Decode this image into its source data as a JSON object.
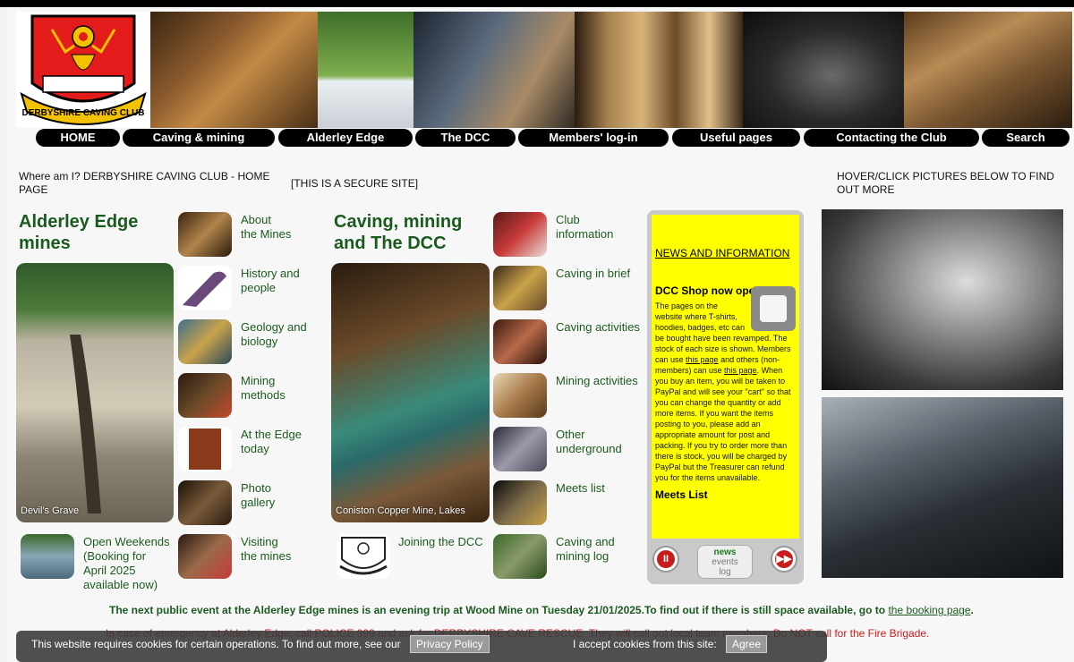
{
  "nav": [
    "HOME",
    "Caving & mining",
    "Alderley Edge",
    "The DCC",
    "Members' log-in",
    "Useful pages",
    "Contacting the Club",
    "Search"
  ],
  "logo": {
    "text": "DERBYSHIRE CAVING CLUB"
  },
  "where_am_i": "Where am I?  DERBYSHIRE CAVING CLUB - HOME PAGE",
  "secure": "[THIS IS A SECURE SITE]",
  "hover_note": "HOVER/CLICK PICTURES BELOW TO FIND OUT MORE",
  "col1": {
    "title_l1": "Alderley Edge",
    "title_l2": "mines",
    "big_caption": "Devil's Grave",
    "items": [
      {
        "l1": "About",
        "l2": "the Mines"
      },
      {
        "l1": "History and",
        "l2": "people"
      },
      {
        "l1": "Geology and",
        "l2": "biology"
      },
      {
        "l1": "Mining",
        "l2": "methods"
      },
      {
        "l1": "At the Edge",
        "l2": "today"
      },
      {
        "l1": "Photo",
        "l2": "gallery"
      },
      {
        "l1": "Visiting",
        "l2": "the mines"
      }
    ],
    "open_weekends": [
      "Open Weekends",
      "(Booking for",
      "April 2025",
      "available now)"
    ]
  },
  "col2": {
    "title_l1": "Caving, mining",
    "title_l2": "and The DCC",
    "big_caption": "Coniston Copper Mine, Lakes",
    "items": [
      {
        "l1": "Club",
        "l2": "information"
      },
      {
        "l1": "Caving in brief",
        "l2": ""
      },
      {
        "l1": "Caving activities",
        "l2": ""
      },
      {
        "l1": "Mining activities",
        "l2": ""
      },
      {
        "l1": "Other",
        "l2": "underground"
      },
      {
        "l1": "Meets list",
        "l2": ""
      },
      {
        "l1": "Caving and",
        "l2": "mining log"
      }
    ],
    "joining": "Joining the DCC"
  },
  "news": {
    "heading": "NEWS AND INFORMATION",
    "shop_title": "DCC Shop now open",
    "body_1": "The pages on the website where T-shirts, hoodies, badges, etc can be bought have been revamped. The stock of each size is shown. Members can use ",
    "link_1": "this page",
    "body_2": " and others (non-members) can use ",
    "link_2": "this page",
    "body_3": ". When you buy an item, you will be taken to PayPal and will see your \"cart\" so that you can change the quantity or add more items. If you want the items posting to you, please add an appropriate amount for post and packing. If you try to order more than there is stock, you will be charged by PayPal but the Treasurer can refund you for the items unavailable.",
    "meets_title": "Meets List",
    "pause_icon": "II",
    "next_icon": "▶▶",
    "tab_news": "news",
    "tab_events": "events",
    "tab_log": "log"
  },
  "public_event": "The next public event at the Alderley Edge mines is an evening trip at Wood Mine on Tuesday 21/01/2025.To find out if there is still space available, go to ",
  "public_link": "the booking page",
  "public_end": ".",
  "emergency": "In case of emergency at Alderley Edge, call POLICE 999 and ask for DERBYSHIRE CAVE RESCUE.  They will call out local team members.  Do NOT call for the Fire Brigade.",
  "cookie": {
    "text": "This website requires cookies for certain operations.  To find out more, see our",
    "policy": "Privacy Policy",
    "accept_text": "I accept cookies from this site:",
    "agree": "Agree"
  }
}
